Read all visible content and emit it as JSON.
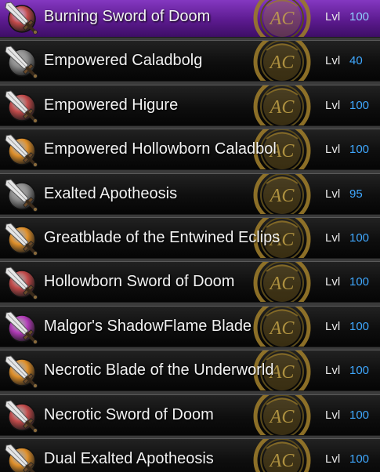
{
  "items": [
    {
      "name": "Burning Sword of Doom",
      "lvl_label": "Lvl",
      "level": "100",
      "icon": "sword-red-icon",
      "icon_color": "#c24a4a",
      "selected": true
    },
    {
      "name": "Empowered Caladbolg",
      "lvl_label": "Lvl",
      "level": "40",
      "icon": "sword-gray-icon",
      "icon_color": "#8a8a8a",
      "selected": false
    },
    {
      "name": "Empowered Higure",
      "lvl_label": "Lvl",
      "level": "100",
      "icon": "sword-red-icon",
      "icon_color": "#c24a4a",
      "selected": false
    },
    {
      "name": "Empowered Hollowborn Caladbol",
      "lvl_label": "Lvl",
      "level": "100",
      "icon": "sword-orange-icon",
      "icon_color": "#e0902a",
      "selected": false
    },
    {
      "name": "Exalted Apotheosis",
      "lvl_label": "Lvl",
      "level": "95",
      "icon": "sword-gray-icon",
      "icon_color": "#8a8a8a",
      "selected": false
    },
    {
      "name": "Greatblade of the Entwined Eclips",
      "lvl_label": "Lvl",
      "level": "100",
      "icon": "sword-orange-icon",
      "icon_color": "#e0902a",
      "selected": false
    },
    {
      "name": "Hollowborn Sword of Doom",
      "lvl_label": "Lvl",
      "level": "100",
      "icon": "sword-red-icon",
      "icon_color": "#c24a4a",
      "selected": false
    },
    {
      "name": "Malgor's ShadowFlame Blade",
      "lvl_label": "Lvl",
      "level": "100",
      "icon": "sword-purple-icon",
      "icon_color": "#b23ab8",
      "selected": false
    },
    {
      "name": "Necrotic Blade of the Underworld",
      "lvl_label": "Lvl",
      "level": "100",
      "icon": "sword-orange-icon",
      "icon_color": "#e0902a",
      "selected": false
    },
    {
      "name": "Necrotic Sword of Doom",
      "lvl_label": "Lvl",
      "level": "100",
      "icon": "sword-red-icon",
      "icon_color": "#c24a4a",
      "selected": false
    },
    {
      "name": "Dual Exalted Apotheosis",
      "lvl_label": "Lvl",
      "level": "100",
      "icon": "sword-orange-icon",
      "icon_color": "#e0902a",
      "selected": false
    }
  ],
  "emblem_text": "AC",
  "colors": {
    "selected_row": "#6a24a8",
    "level_value": "#3fa8ff",
    "emblem_gold": "#9a7a2a"
  }
}
